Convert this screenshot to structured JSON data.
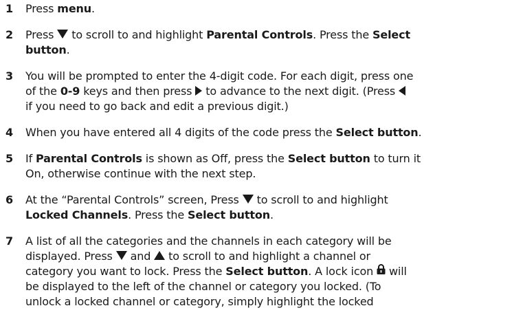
{
  "steps": [
    {
      "number": "1",
      "lines": [
        [
          "Press ",
          {
            "b": "menu"
          },
          "."
        ]
      ]
    },
    {
      "number": "2",
      "lines": [
        [
          "Press ",
          {
            "icon": "down"
          },
          " to scroll to and highlight ",
          {
            "b": "Parental Controls"
          },
          ". Press the ",
          {
            "b": "Select"
          }
        ],
        [
          {
            "b": "button"
          },
          "."
        ]
      ]
    },
    {
      "number": "3",
      "lines": [
        [
          "You will be prompted to enter the 4-digit code. For each digit, press one"
        ],
        [
          "of the ",
          {
            "b": "0-9"
          },
          " keys and then press ",
          {
            "icon": "right"
          },
          " to advance to the next digit. (Press ",
          {
            "icon": "left"
          }
        ],
        [
          "if you need to go back and edit a previous digit.)"
        ]
      ]
    },
    {
      "number": "4",
      "lines": [
        [
          "When you have entered all 4 digits of the code press the ",
          {
            "b": "Select button"
          },
          "."
        ]
      ]
    },
    {
      "number": "5",
      "lines": [
        [
          "If ",
          {
            "b": "Parental Controls"
          },
          " is shown as Off, press the ",
          {
            "b": "Select button"
          },
          " to turn it"
        ],
        [
          "On, otherwise continue with the next step."
        ]
      ]
    },
    {
      "number": "6",
      "lines": [
        [
          "At the “Parental Controls” screen, Press ",
          {
            "icon": "down"
          },
          " to scroll to and highlight"
        ],
        [
          {
            "b": "Locked Channels"
          },
          ". Press the ",
          {
            "b": "Select button"
          },
          "."
        ]
      ]
    },
    {
      "number": "7",
      "lines": [
        [
          "A list of all the categories and the channels in each category will be"
        ],
        [
          "displayed. Press ",
          {
            "icon": "down"
          },
          " and ",
          {
            "icon": "up"
          },
          " to scroll to and highlight a channel or"
        ],
        [
          "category you want to lock. Press the ",
          {
            "b": "Select button"
          },
          ". A lock icon ",
          {
            "icon": "lock"
          },
          " will"
        ],
        [
          "be displayed to the left of the channel or category you locked. (To"
        ],
        [
          "unlock a locked channel or category, simply highlight the locked"
        ]
      ]
    }
  ],
  "icons": {
    "down": "down-arrow-icon",
    "up": "up-arrow-icon",
    "right": "right-arrow-icon",
    "left": "left-arrow-icon",
    "lock": "lock-icon"
  }
}
